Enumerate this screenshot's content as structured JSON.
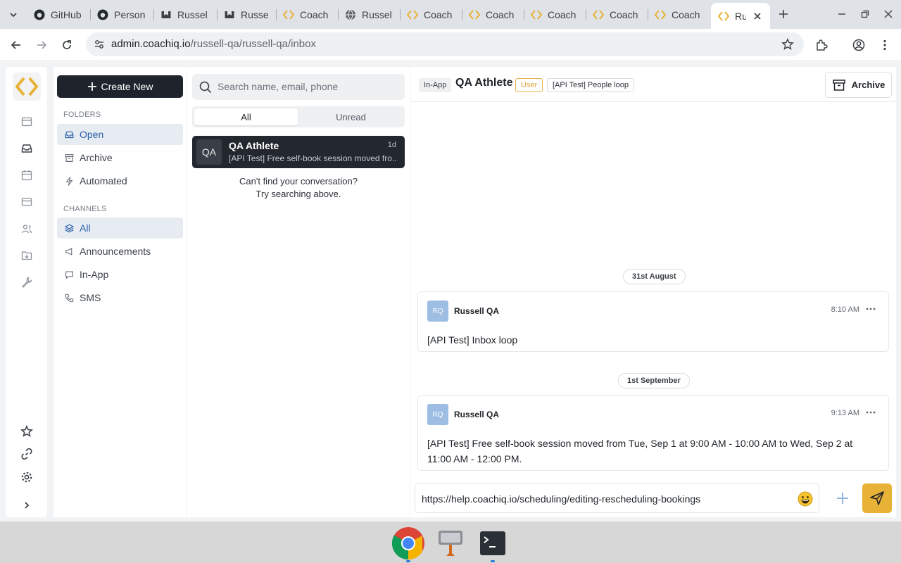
{
  "browser": {
    "tabs": [
      {
        "title": "GitHub",
        "icon": "github-icon"
      },
      {
        "title": "Person",
        "icon": "github-icon"
      },
      {
        "title": "Russel",
        "icon": "mail-icon"
      },
      {
        "title": "Russel",
        "icon": "mail-icon"
      },
      {
        "title": "Coach",
        "icon": "coachiq-icon"
      },
      {
        "title": "Russel",
        "icon": "globe-icon"
      },
      {
        "title": "Coach",
        "icon": "coachiq-icon"
      },
      {
        "title": "Coach",
        "icon": "coachiq-icon"
      },
      {
        "title": "Coach",
        "icon": "coachiq-icon"
      },
      {
        "title": "Coach",
        "icon": "coachiq-icon"
      },
      {
        "title": "Coach",
        "icon": "coachiq-icon"
      },
      {
        "title": "Ru",
        "icon": "coachiq-icon",
        "active": true
      }
    ],
    "url_host": "admin.coachiq.io",
    "url_path": "/russell-qa/russell-qa/inbox"
  },
  "sidebar": {
    "create_label": "Create New",
    "folders_title": "FOLDERS",
    "folders": [
      {
        "label": "Open",
        "icon": "inbox-icon",
        "selected": true
      },
      {
        "label": "Archive",
        "icon": "archive-icon"
      },
      {
        "label": "Automated",
        "icon": "bolt-icon"
      }
    ],
    "channels_title": "CHANNELS",
    "channels": [
      {
        "label": "All",
        "icon": "layers-icon",
        "selected": true
      },
      {
        "label": "Announcements",
        "icon": "megaphone-icon"
      },
      {
        "label": "In-App",
        "icon": "chat-icon"
      },
      {
        "label": "SMS",
        "icon": "phone-icon"
      }
    ]
  },
  "conversations": {
    "search_placeholder": "Search name, email, phone",
    "filter_all": "All",
    "filter_unread": "Unread",
    "items": [
      {
        "initials": "QA",
        "name": "QA Athlete",
        "time": "1d",
        "preview": "[API Test] Free self-book session moved fro..."
      }
    ],
    "not_found_line1": "Can't find your conversation?",
    "not_found_line2": "Try searching above."
  },
  "chat": {
    "channel_tag": "In-App",
    "title": "QA Athlete",
    "role_tag": "User",
    "group_tag": "[API Test] People loop",
    "archive_label": "Archive",
    "messages": [
      {
        "date": "31st August",
        "initials": "RQ",
        "sender": "Russell QA",
        "time": "8:10 AM",
        "body": "[API Test] Inbox loop"
      },
      {
        "date": "1st September",
        "initials": "RQ",
        "sender": "Russell QA",
        "time": "9:13 AM",
        "body": "[API Test] Free self-book session moved from Tue, Sep 1 at 9:00 AM - 10:00 AM to Wed, Sep 2 at 11:00 AM - 12:00 PM."
      }
    ],
    "composer_value": "https://help.coachiq.io/scheduling/editing-rescheduling-bookings"
  },
  "colors": {
    "accent": "#e8b237",
    "dark_button": "#1f242c",
    "selected_bg": "#e7ecf3",
    "selected_text": "#2c5fa8"
  }
}
